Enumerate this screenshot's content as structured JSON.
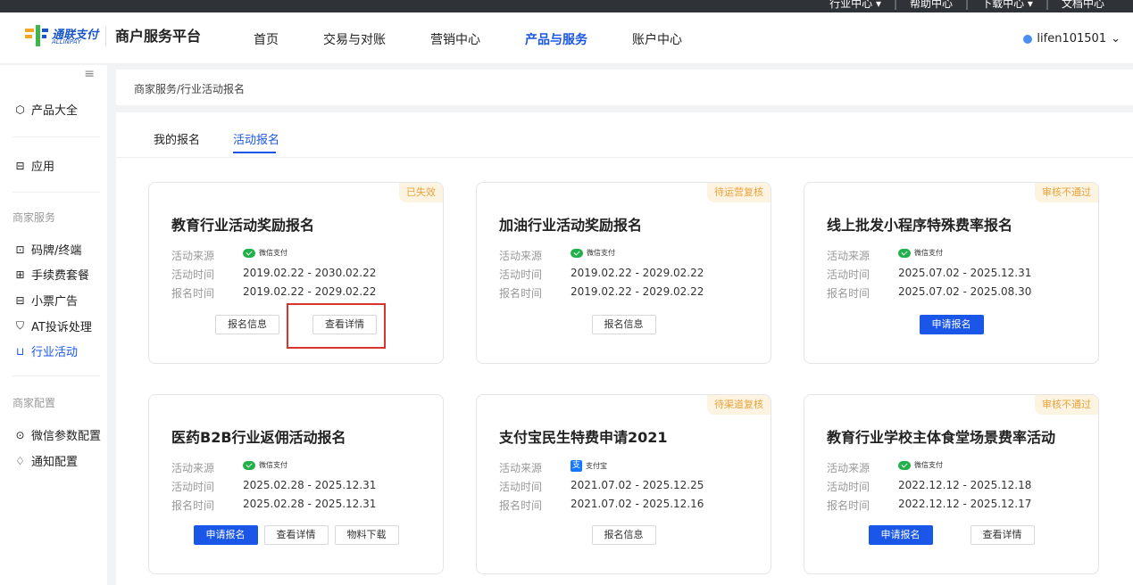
{
  "topbar": {
    "links": [
      "行业中心 ▾",
      "帮助中心",
      "下载中心 ▾",
      "文档中心"
    ]
  },
  "header": {
    "logo_cn": "通联支付",
    "logo_en": "ALLINPAY",
    "platform": "商户服务平台",
    "nav": [
      "首页",
      "交易与对账",
      "营销中心",
      "产品与服务",
      "账户中心"
    ],
    "nav_active": "产品与服务",
    "user": "lifen101501",
    "user_arrow": "⌄"
  },
  "sidebar": {
    "collapse": "≡",
    "main": [
      {
        "label": "产品大全",
        "icon": "cube-icon",
        "glyph": "⬡"
      },
      {
        "label": "应用",
        "icon": "app-icon",
        "glyph": "⊟"
      }
    ],
    "groups": [
      {
        "title": "商家服务",
        "items": [
          {
            "label": "码牌/终端",
            "icon": "terminal-icon",
            "glyph": "⊡"
          },
          {
            "label": "手续费套餐",
            "icon": "package-icon",
            "glyph": "⊞"
          },
          {
            "label": "小票广告",
            "icon": "receipt-icon",
            "glyph": "⊟"
          },
          {
            "label": "AT投诉处理",
            "icon": "shield-icon",
            "glyph": "⛉"
          },
          {
            "label": "行业活动",
            "icon": "cart-icon",
            "glyph": "⊔"
          }
        ]
      },
      {
        "title": "商家配置",
        "items": [
          {
            "label": "微信参数配置",
            "icon": "wechat-config-icon",
            "glyph": "⊙"
          },
          {
            "label": "通知配置",
            "icon": "bell-icon",
            "glyph": "♢"
          }
        ]
      }
    ],
    "active": "行业活动"
  },
  "breadcrumb": "商家服务/行业活动报名",
  "tabs": [
    "我的报名",
    "活动报名"
  ],
  "tab_active": "活动报名",
  "labels": {
    "source": "活动来源",
    "activity_time": "活动时间",
    "signup_time": "报名时间"
  },
  "cards": [
    {
      "badge": "已失效",
      "title": "教育行业活动奖励报名",
      "source": "微信支付",
      "source_type": "wechat",
      "activity_time": "2019.02.22 - 2030.02.22",
      "signup_time": "2019.02.22 - 2029.02.22",
      "buttons": [
        {
          "label": "报名信息",
          "primary": false
        },
        {
          "label": "查看详情",
          "primary": false
        }
      ]
    },
    {
      "badge": "待运营复核",
      "title": "加油行业活动奖励报名",
      "source": "微信支付",
      "source_type": "wechat",
      "activity_time": "2019.02.22 - 2029.02.22",
      "signup_time": "2019.02.22 - 2029.02.22",
      "buttons": [
        {
          "label": "报名信息",
          "primary": false
        }
      ]
    },
    {
      "badge": "审核不通过",
      "title": "线上批发小程序特殊费率报名",
      "source": "微信支付",
      "source_type": "wechat",
      "activity_time": "2025.07.02 - 2025.12.31",
      "signup_time": "2025.07.02 - 2025.08.30",
      "buttons": [
        {
          "label": "申请报名",
          "primary": true
        }
      ]
    },
    {
      "badge": "",
      "title": "医药B2B行业返佣活动报名",
      "source": "微信支付",
      "source_type": "wechat",
      "activity_time": "2025.02.28 - 2025.12.31",
      "signup_time": "2025.02.28 - 2025.12.31",
      "buttons": [
        {
          "label": "申请报名",
          "primary": true
        },
        {
          "label": "查看详情",
          "primary": false
        },
        {
          "label": "物料下载",
          "primary": false
        }
      ]
    },
    {
      "badge": "待渠道复核",
      "title": "支付宝民生特费申请2021",
      "source": "支付宝",
      "source_type": "alipay",
      "activity_time": "2021.07.02 - 2025.12.25",
      "signup_time": "2021.07.02 - 2025.12.16",
      "buttons": [
        {
          "label": "报名信息",
          "primary": false
        }
      ]
    },
    {
      "badge": "审核不通过",
      "title": "教育行业学校主体食堂场景费率活动",
      "source": "微信支付",
      "source_type": "wechat",
      "activity_time": "2022.12.12 - 2025.12.18",
      "signup_time": "2022.12.12 - 2025.12.17",
      "buttons": [
        {
          "label": "申请报名",
          "primary": true
        },
        {
          "label": "查看详情",
          "primary": false
        }
      ]
    }
  ],
  "colors": {
    "accent": "#1a56e8",
    "badge_text": "#e8a33c",
    "badge_bg": "#fdf3e1",
    "highlight": "#d9352a",
    "wechat": "#22b04a",
    "alipay": "#1677ff"
  }
}
